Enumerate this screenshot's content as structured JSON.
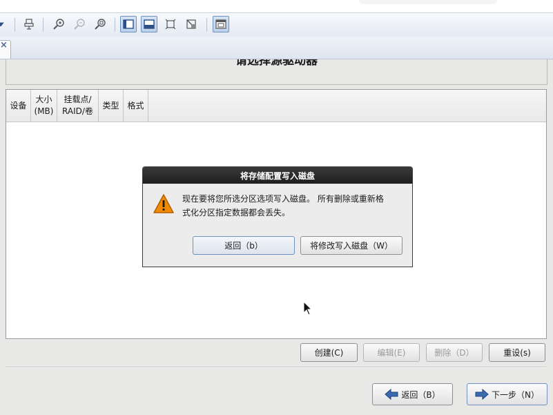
{
  "toolbar": {
    "icons": [
      "menu-dropdown-icon",
      "usb-device-icon",
      "zoom-in-icon",
      "zoom-out-icon",
      "zoom-fit-icon",
      "sidebar-left-icon",
      "panel-bottom-icon",
      "fullscreen-icon",
      "fullscreen-off-icon",
      "window-icon"
    ]
  },
  "page": {
    "title": "请选择源驱动器"
  },
  "table": {
    "columns": [
      "设备",
      "大小\n(MB)",
      "挂载点/\nRAID/卷",
      "类型",
      "格式"
    ]
  },
  "actions": {
    "create": "创建(C)",
    "edit": "编辑(E)",
    "delete": "删除（D）",
    "reset": "重设(s)"
  },
  "nav": {
    "back": "返回（B）",
    "next": "下一步（N）"
  },
  "dialog": {
    "title": "将存储配置写入磁盘",
    "message_line1": "现在要将您所选分区选项写入磁盘。 所有删除或重新格",
    "message_line2": "式化分区指定数据都会丢失。",
    "back": "返回（b）",
    "write": "将修改写入磁盘（W）"
  },
  "colors": {
    "dialog_title_bg": "#2a2a2a",
    "warning": "#f08a00",
    "accent": "#3a6bb0"
  }
}
